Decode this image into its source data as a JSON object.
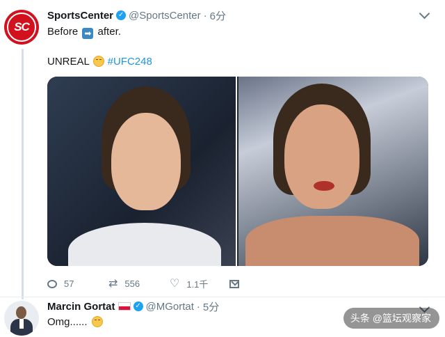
{
  "tweet": {
    "display_name": "SportsCenter",
    "avatar_text": "SC",
    "handle": "@SportsCenter",
    "separator": "·",
    "time": "6分",
    "line1_before": "Before",
    "line1_arrow": "➡",
    "line1_after": "after.",
    "line2_text": "UNREAL",
    "line2_hashtag": "#UFC248",
    "actions": {
      "replies": "57",
      "retweets": "556",
      "likes": "1.1千"
    }
  },
  "reply": {
    "display_name": "Marcin Gortat",
    "handle": "@MGortat",
    "separator": "·",
    "time": "5分",
    "text": "Omg......"
  },
  "watermark": {
    "text": "头条 @篮坛观察家"
  },
  "colors": {
    "brand_red": "#d2101e",
    "verified_blue": "#1da1f2",
    "hashtag_blue": "#1b95e0",
    "muted_gray": "#657786",
    "thread_line": "#d3dee8"
  },
  "icons": [
    "verified-badge-icon",
    "chevron-down-icon",
    "arrow-right-icon",
    "smile-emoji-icon",
    "reply-icon",
    "retweet-icon",
    "like-icon",
    "direct-message-icon",
    "poland-flag-icon"
  ]
}
